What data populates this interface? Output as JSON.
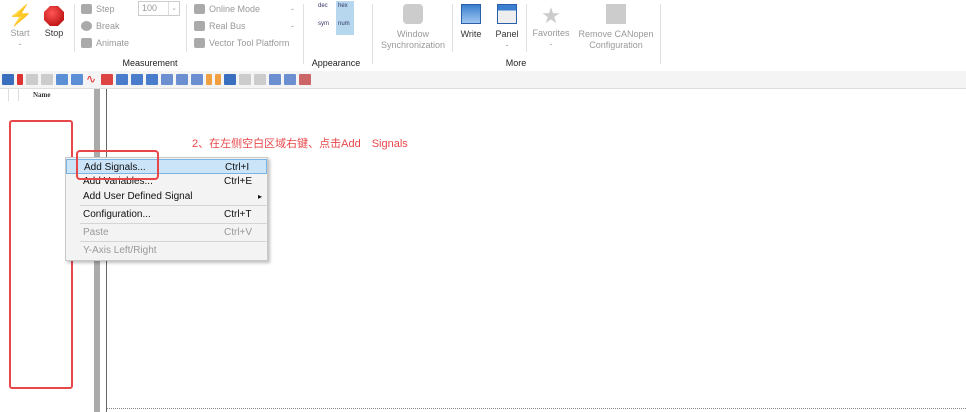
{
  "ribbon": {
    "start": "Start",
    "start_sub": "-",
    "stop": "Stop",
    "step": "Step",
    "break": "Break",
    "animate": "Animate",
    "step_value": "100",
    "online_mode": "Online Mode",
    "real_bus": "Real Bus",
    "vector_tool_platform": "Vector Tool Platform",
    "dash": "-",
    "measurement_label": "Measurement",
    "dec": "dec",
    "hex": "hex",
    "sym": "sym",
    "num": "num",
    "appearance_label": "Appearance",
    "window_sync_1": "Window",
    "window_sync_2": "Synchronization",
    "write": "Write",
    "panel": "Panel",
    "favorites": "Favorites",
    "remove_1": "Remove CANopen",
    "remove_2": "Configuration",
    "more_label": "More"
  },
  "signal_list": {
    "name_header": "Name"
  },
  "annotation": {
    "text": "2、在左侧空白区域右键、点击Add　Signals",
    "color": "#e8474a"
  },
  "context_menu": {
    "items": [
      {
        "label": "Add Signals...",
        "shortcut": "Ctrl+I"
      },
      {
        "label": "Add Variables...",
        "shortcut": "Ctrl+E"
      },
      {
        "label": "Add User Defined Signal",
        "shortcut": "▸"
      },
      {
        "label": "Configuration...",
        "shortcut": "Ctrl+T"
      },
      {
        "label": "Paste",
        "shortcut": "Ctrl+V"
      },
      {
        "label": "Y-Axis Left/Right",
        "shortcut": ""
      }
    ]
  }
}
